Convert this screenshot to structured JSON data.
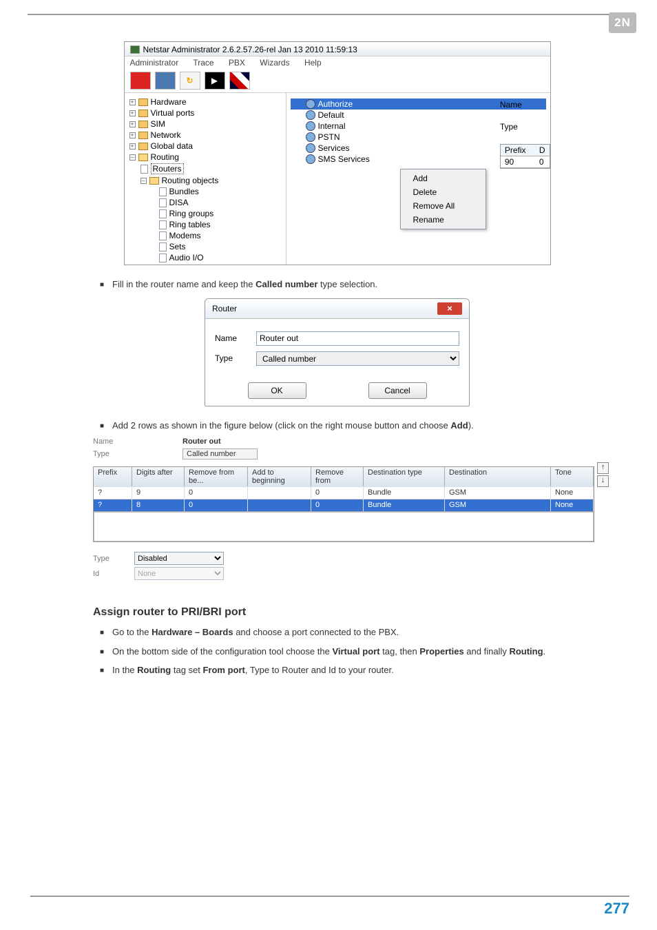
{
  "logo": "2N",
  "ss1": {
    "title": "Netstar Administrator 2.6.2.57.26-rel Jan 13 2010 11:59:13",
    "menu": [
      "Administrator",
      "Trace",
      "PBX",
      "Wizards",
      "Help"
    ],
    "tree": {
      "hardware": "Hardware",
      "virtual_ports": "Virtual ports",
      "sim": "SIM",
      "network": "Network",
      "global_data": "Global data",
      "routing": "Routing",
      "routers": "Routers",
      "routing_objects": "Routing objects",
      "bundles": "Bundles",
      "disa": "DISA",
      "ring_groups": "Ring groups",
      "ring_tables": "Ring tables",
      "modems": "Modems",
      "sets": "Sets",
      "audio_io": "Audio I/O"
    },
    "rlist": {
      "authorize": "Authorize",
      "default": "Default",
      "internal": "Internal",
      "pstn": "PSTN",
      "services": "Services",
      "sms": "SMS Services"
    },
    "right": {
      "name_lbl": "Name",
      "type_lbl": "Type",
      "prefix_lbl": "Prefix",
      "d_lbl": "D",
      "ninety": "90",
      "zero": "0"
    },
    "ctx": {
      "add": "Add",
      "delete": "Delete",
      "remove_all": "Remove All",
      "rename": "Rename"
    }
  },
  "bullet1_pre": "Fill in the router name and keep the ",
  "bullet1_bold": "Called number",
  "bullet1_post": " type selection.",
  "ss2": {
    "title": "Router",
    "name_lbl": "Name",
    "name_val": "Router out",
    "type_lbl": "Type",
    "type_val": "Called number",
    "ok": "OK",
    "cancel": "Cancel"
  },
  "bullet2_pre": "Add 2 rows as shown in the figure below (click on the right mouse button and choose ",
  "bullet2_bold": "Add",
  "bullet2_post": ").",
  "ss3": {
    "name_lbl": "Name",
    "name_val": "Router out",
    "type_lbl": "Type",
    "type_val": "Called number",
    "cols": [
      "Prefix",
      "Digits after",
      "Remove from be...",
      "Add to beginning",
      "Remove from",
      "Destination type",
      "Destination",
      "Tone"
    ],
    "rows": [
      {
        "prefix": "?",
        "digits": "9",
        "remove_be": "0",
        "add": "",
        "remove_from": "0",
        "dtype": "Bundle",
        "dest": "GSM",
        "tone": "None"
      },
      {
        "prefix": "?",
        "digits": "8",
        "remove_be": "0",
        "add": "",
        "remove_from": "0",
        "dtype": "Bundle",
        "dest": "GSM",
        "tone": "None"
      }
    ],
    "btm_type_lbl": "Type",
    "btm_type_val": "Disabled",
    "btm_id_lbl": "Id",
    "btm_id_val": "None"
  },
  "heading": "Assign router to PRI/BRI port",
  "b3": [
    "Go to the ",
    "Hardware – Boards",
    " and choose a port connected to the PBX."
  ],
  "b4": [
    "On the bottom side of the configuration tool choose the ",
    "Virtual port",
    " tag, then ",
    "Properties",
    " and finally ",
    "Routing",
    "."
  ],
  "b5": [
    "In the ",
    "Routing",
    " tag set ",
    "From port",
    ", Type to Router and Id to your router."
  ],
  "page_num": "277"
}
